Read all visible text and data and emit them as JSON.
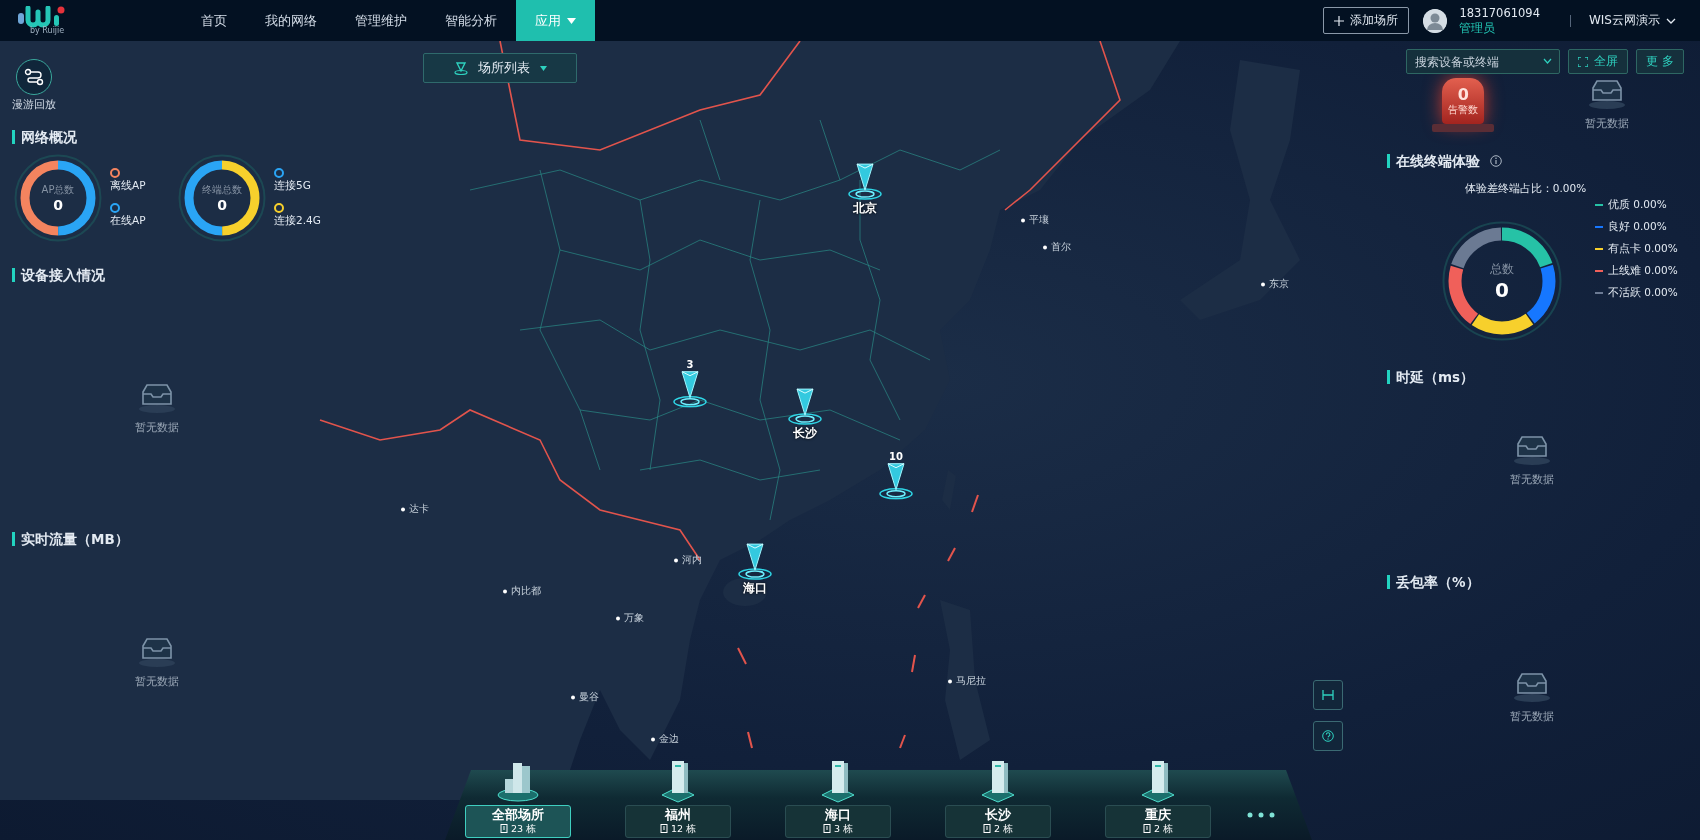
{
  "header": {
    "logo_caption": "by Ruijie",
    "nav": [
      {
        "label": "首页",
        "selected": false,
        "dropdown": false
      },
      {
        "label": "我的网络",
        "selected": false,
        "dropdown": false
      },
      {
        "label": "管理维护",
        "selected": false,
        "dropdown": false
      },
      {
        "label": "智能分析",
        "selected": false,
        "dropdown": false
      },
      {
        "label": "应用",
        "selected": true,
        "dropdown": true
      }
    ],
    "add_button": "添加场所",
    "user": {
      "phone": "18317061094",
      "role": "管理员"
    },
    "org": "WIS云网演示"
  },
  "left": {
    "replay": "漫游回放",
    "overview": {
      "title": "网络概况",
      "donuts": [
        {
          "label": "AP总数",
          "value": "0",
          "legend": [
            {
              "label": "离线AP",
              "color": "#f4845f"
            },
            {
              "label": "在线AP",
              "color": "#2aa5f5"
            }
          ]
        },
        {
          "label": "终端总数",
          "value": "0",
          "legend": [
            {
              "label": "连接5G",
              "color": "#2aa5f5"
            },
            {
              "label": "连接2.4G",
              "color": "#f7d02c"
            }
          ]
        }
      ]
    },
    "sections": [
      {
        "title": "设备接入情况",
        "empty": "暂无数据"
      },
      {
        "title": "实时流量（MB）",
        "empty": "暂无数据"
      }
    ]
  },
  "site_list_button": "场所列表",
  "map": {
    "markers": [
      {
        "kind": "named",
        "text": "北京"
      },
      {
        "kind": "count",
        "text": "3"
      },
      {
        "kind": "named",
        "text": "长沙"
      },
      {
        "kind": "count",
        "text": "10"
      },
      {
        "kind": "named",
        "text": "海口"
      }
    ],
    "cities": [
      "平壤",
      "首尔",
      "东京",
      "达卡",
      "内比都",
      "河内",
      "万象",
      "曼谷",
      "金边",
      "马尼拉"
    ]
  },
  "right": {
    "search": {
      "placeholder": "搜索设备或终端"
    },
    "fullscreen": "全屏",
    "more": "更多",
    "alarm": {
      "value": "0",
      "label": "告警数"
    },
    "alarm_empty": "暂无数据",
    "experience": {
      "title": "在线终端体验",
      "ratio": "体验差终端占比：0.00%",
      "total_label": "总数",
      "total": "0",
      "legend": [
        {
          "text": "优质 0.00%",
          "color": "#26c2a6"
        },
        {
          "text": "良好 0.00%",
          "color": "#1677ff"
        },
        {
          "text": "有点卡 0.00%",
          "color": "#f7d02c"
        },
        {
          "text": "上线难 0.00%",
          "color": "#f0605a"
        },
        {
          "text": "不活跃 0.00%",
          "color": "#6b7a93"
        }
      ]
    },
    "sections": [
      {
        "title": "时延（ms）",
        "empty": "暂无数据"
      },
      {
        "title": "丢包率（%）",
        "empty": "暂无数据"
      }
    ]
  },
  "sites": [
    {
      "kind": "all",
      "name": "全部场所",
      "count": "23 栋",
      "selected": true
    },
    {
      "kind": "single",
      "name": "福州",
      "count": "12 栋",
      "selected": false
    },
    {
      "kind": "single",
      "name": "海口",
      "count": "3 栋",
      "selected": false
    },
    {
      "kind": "single",
      "name": "长沙",
      "count": "2 栋",
      "selected": false
    },
    {
      "kind": "single",
      "name": "重庆",
      "count": "2 栋",
      "selected": false
    }
  ]
}
